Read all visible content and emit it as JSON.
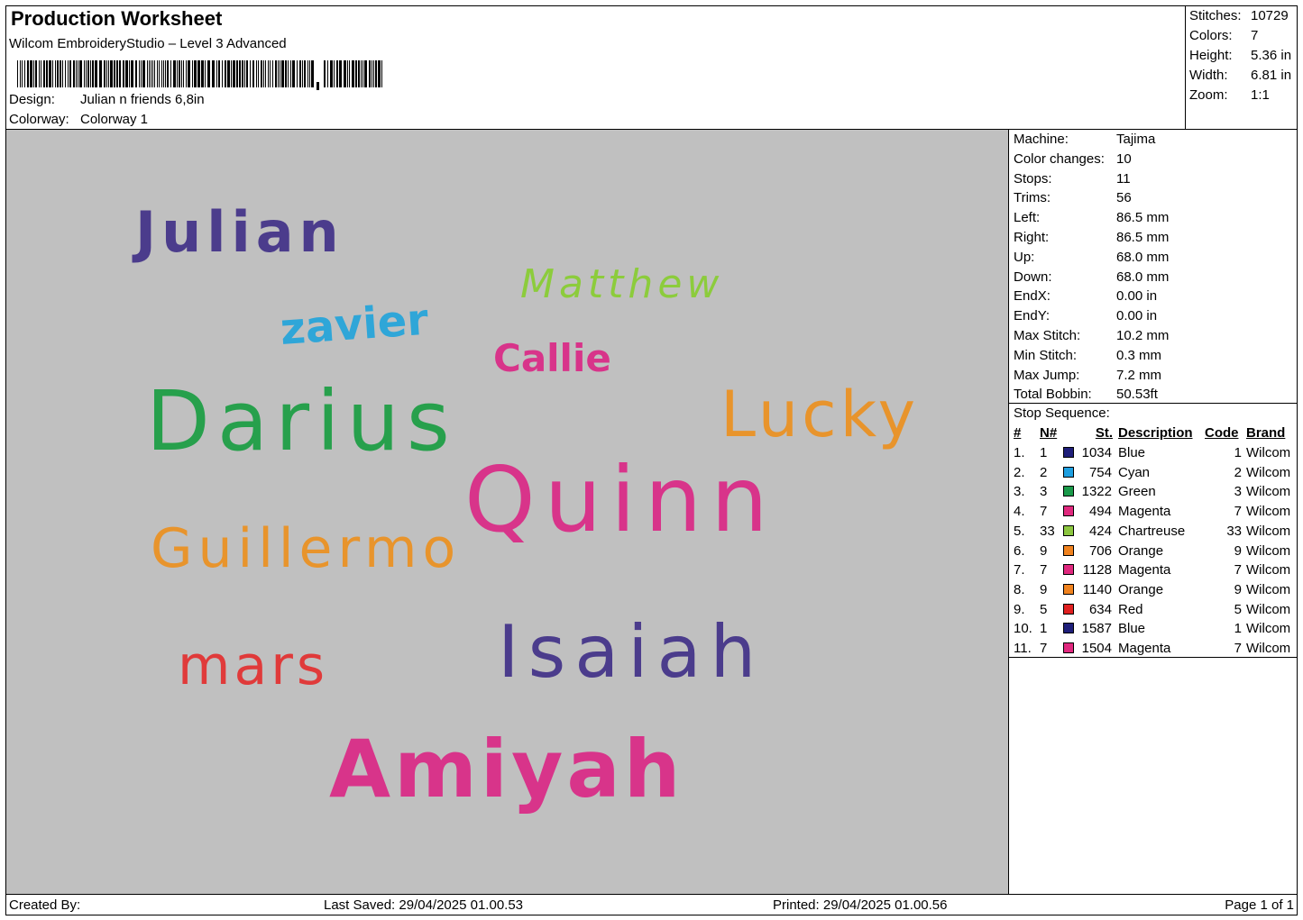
{
  "header": {
    "title": "Production Worksheet",
    "software": "Wilcom EmbroideryStudio – Level 3 Advanced",
    "design_label": "Design:",
    "design_value": "Julian n friends 6,8in",
    "colorway_label": "Colorway:",
    "colorway_value": "Colorway 1"
  },
  "summary": [
    {
      "label": "Stitches:",
      "value": "10729"
    },
    {
      "label": "Colors:",
      "value": "7"
    },
    {
      "label": "Height:",
      "value": "5.36 in"
    },
    {
      "label": "Width:",
      "value": "6.81 in"
    },
    {
      "label": "Zoom:",
      "value": "1:1"
    }
  ],
  "machine_info": [
    {
      "label": "Machine:",
      "value": "Tajima"
    },
    {
      "label": "Color changes:",
      "value": "10"
    },
    {
      "label": "Stops:",
      "value": "11"
    },
    {
      "label": "Trims:",
      "value": "56"
    },
    {
      "label": "Left:",
      "value": "86.5 mm"
    },
    {
      "label": "Right:",
      "value": "86.5 mm"
    },
    {
      "label": "Up:",
      "value": "68.0 mm"
    },
    {
      "label": "Down:",
      "value": "68.0 mm"
    },
    {
      "label": "EndX:",
      "value": "0.00 in"
    },
    {
      "label": "EndY:",
      "value": "0.00 in"
    },
    {
      "label": "Max Stitch:",
      "value": "10.2 mm"
    },
    {
      "label": "Min Stitch:",
      "value": "0.3 mm"
    },
    {
      "label": "Max Jump:",
      "value": "7.2 mm"
    },
    {
      "label": "Total Bobbin:",
      "value": "50.53ft"
    }
  ],
  "stop_sequence": {
    "title": "Stop Sequence:",
    "headers": {
      "idx": "#",
      "n": "N#",
      "st": "St.",
      "desc": "Description",
      "code": "Code",
      "brand": "Brand"
    },
    "rows": [
      {
        "idx": "1.",
        "n": "1",
        "color": "#1f1f7a",
        "st": "1034",
        "desc": "Blue",
        "code": "1",
        "brand": "Wilcom"
      },
      {
        "idx": "2.",
        "n": "2",
        "color": "#1e9fe0",
        "st": "754",
        "desc": "Cyan",
        "code": "2",
        "brand": "Wilcom"
      },
      {
        "idx": "3.",
        "n": "3",
        "color": "#1a9a4a",
        "st": "1322",
        "desc": "Green",
        "code": "3",
        "brand": "Wilcom"
      },
      {
        "idx": "4.",
        "n": "7",
        "color": "#e0287e",
        "st": "494",
        "desc": "Magenta",
        "code": "7",
        "brand": "Wilcom"
      },
      {
        "idx": "5.",
        "n": "33",
        "color": "#8cc63f",
        "st": "424",
        "desc": "Chartreuse",
        "code": "33",
        "brand": "Wilcom"
      },
      {
        "idx": "6.",
        "n": "9",
        "color": "#f0821e",
        "st": "706",
        "desc": "Orange",
        "code": "9",
        "brand": "Wilcom"
      },
      {
        "idx": "7.",
        "n": "7",
        "color": "#e0287e",
        "st": "1128",
        "desc": "Magenta",
        "code": "7",
        "brand": "Wilcom"
      },
      {
        "idx": "8.",
        "n": "9",
        "color": "#f0821e",
        "st": "1140",
        "desc": "Orange",
        "code": "9",
        "brand": "Wilcom"
      },
      {
        "idx": "9.",
        "n": "5",
        "color": "#e02020",
        "st": "634",
        "desc": "Red",
        "code": "5",
        "brand": "Wilcom"
      },
      {
        "idx": "10.",
        "n": "1",
        "color": "#1f1f7a",
        "st": "1587",
        "desc": "Blue",
        "code": "1",
        "brand": "Wilcom"
      },
      {
        "idx": "11.",
        "n": "7",
        "color": "#e0287e",
        "st": "1504",
        "desc": "Magenta",
        "code": "7",
        "brand": "Wilcom"
      }
    ]
  },
  "design_names": [
    {
      "text": "Julian",
      "color": "#4b3c8c"
    },
    {
      "text": "Matthew",
      "color": "#8ccc3c"
    },
    {
      "text": "zavier",
      "color": "#2fa6d8"
    },
    {
      "text": "Callie",
      "color": "#d8348a"
    },
    {
      "text": "Darius",
      "color": "#27a04c"
    },
    {
      "text": "Lucky",
      "color": "#e8942c"
    },
    {
      "text": "Quinn",
      "color": "#d8348a"
    },
    {
      "text": "Guillermo",
      "color": "#e8942c"
    },
    {
      "text": "Isaiah",
      "color": "#4b3c8c"
    },
    {
      "text": "mars",
      "color": "#e03a3a"
    },
    {
      "text": "Amiyah",
      "color": "#d8348a"
    }
  ],
  "footer": {
    "created_by": "Created By:",
    "last_saved": "Last Saved: 29/04/2025 01.00.53",
    "printed": "Printed: 29/04/2025 01.00.56",
    "page": "Page 1 of 1"
  }
}
